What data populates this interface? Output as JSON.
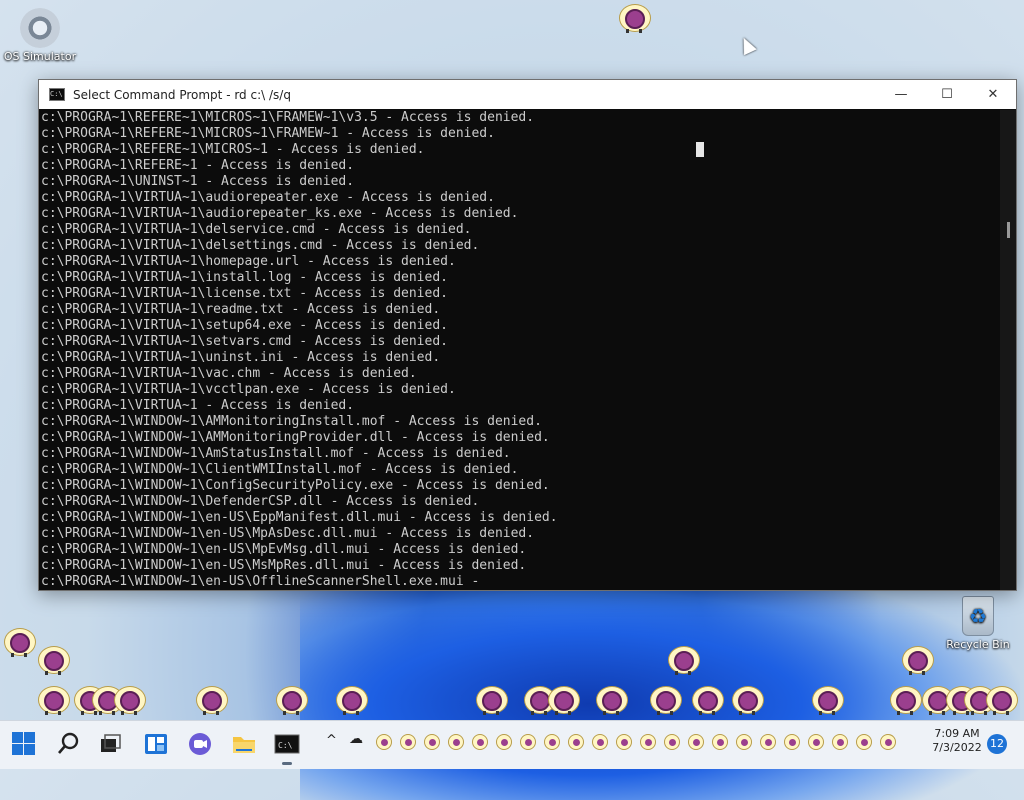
{
  "desktop": {
    "icons": [
      {
        "label": "OS Simulator",
        "icon": "gear-icon"
      },
      {
        "label": "Recycle Bin",
        "icon": "recycle-bin-icon"
      }
    ]
  },
  "window": {
    "title": "Select Command Prompt - rd  c:\\ /s/q",
    "controls": {
      "minimize": "—",
      "maximize": "☐",
      "close": "✕"
    },
    "lines": [
      "c:\\PROGRA~1\\REFERE~1\\MICROS~1\\FRAMEW~1\\v3.5 - Access is denied.",
      "c:\\PROGRA~1\\REFERE~1\\MICROS~1\\FRAMEW~1 - Access is denied.",
      "c:\\PROGRA~1\\REFERE~1\\MICROS~1 - Access is denied.",
      "c:\\PROGRA~1\\REFERE~1 - Access is denied.",
      "c:\\PROGRA~1\\UNINST~1 - Access is denied.",
      "c:\\PROGRA~1\\VIRTUA~1\\audiorepeater.exe - Access is denied.",
      "c:\\PROGRA~1\\VIRTUA~1\\audiorepeater_ks.exe - Access is denied.",
      "c:\\PROGRA~1\\VIRTUA~1\\delservice.cmd - Access is denied.",
      "c:\\PROGRA~1\\VIRTUA~1\\delsettings.cmd - Access is denied.",
      "c:\\PROGRA~1\\VIRTUA~1\\homepage.url - Access is denied.",
      "c:\\PROGRA~1\\VIRTUA~1\\install.log - Access is denied.",
      "c:\\PROGRA~1\\VIRTUA~1\\license.txt - Access is denied.",
      "c:\\PROGRA~1\\VIRTUA~1\\readme.txt - Access is denied.",
      "c:\\PROGRA~1\\VIRTUA~1\\setup64.exe - Access is denied.",
      "c:\\PROGRA~1\\VIRTUA~1\\setvars.cmd - Access is denied.",
      "c:\\PROGRA~1\\VIRTUA~1\\uninst.ini - Access is denied.",
      "c:\\PROGRA~1\\VIRTUA~1\\vac.chm - Access is denied.",
      "c:\\PROGRA~1\\VIRTUA~1\\vcctlpan.exe - Access is denied.",
      "c:\\PROGRA~1\\VIRTUA~1 - Access is denied.",
      "c:\\PROGRA~1\\WINDOW~1\\AMMonitoringInstall.mof - Access is denied.",
      "c:\\PROGRA~1\\WINDOW~1\\AMMonitoringProvider.dll - Access is denied.",
      "c:\\PROGRA~1\\WINDOW~1\\AmStatusInstall.mof - Access is denied.",
      "c:\\PROGRA~1\\WINDOW~1\\ClientWMIInstall.mof - Access is denied.",
      "c:\\PROGRA~1\\WINDOW~1\\ConfigSecurityPolicy.exe - Access is denied.",
      "c:\\PROGRA~1\\WINDOW~1\\DefenderCSP.dll - Access is denied.",
      "c:\\PROGRA~1\\WINDOW~1\\en-US\\EppManifest.dll.mui - Access is denied.",
      "c:\\PROGRA~1\\WINDOW~1\\en-US\\MpAsDesc.dll.mui - Access is denied.",
      "c:\\PROGRA~1\\WINDOW~1\\en-US\\MpEvMsg.dll.mui - Access is denied.",
      "c:\\PROGRA~1\\WINDOW~1\\en-US\\MsMpRes.dll.mui - Access is denied.",
      "c:\\PROGRA~1\\WINDOW~1\\en-US\\OfflineScannerShell.exe.mui -"
    ]
  },
  "taskbar": {
    "icons": [
      "start-icon",
      "search-icon",
      "task-view-icon",
      "widgets-icon",
      "chat-icon",
      "file-explorer-icon",
      "command-prompt-icon"
    ],
    "tray": {
      "chevron": "^",
      "onedrive": "☁"
    },
    "clock": {
      "time": "7:09 AM",
      "date": "7/3/2022"
    },
    "notifications": "12"
  }
}
